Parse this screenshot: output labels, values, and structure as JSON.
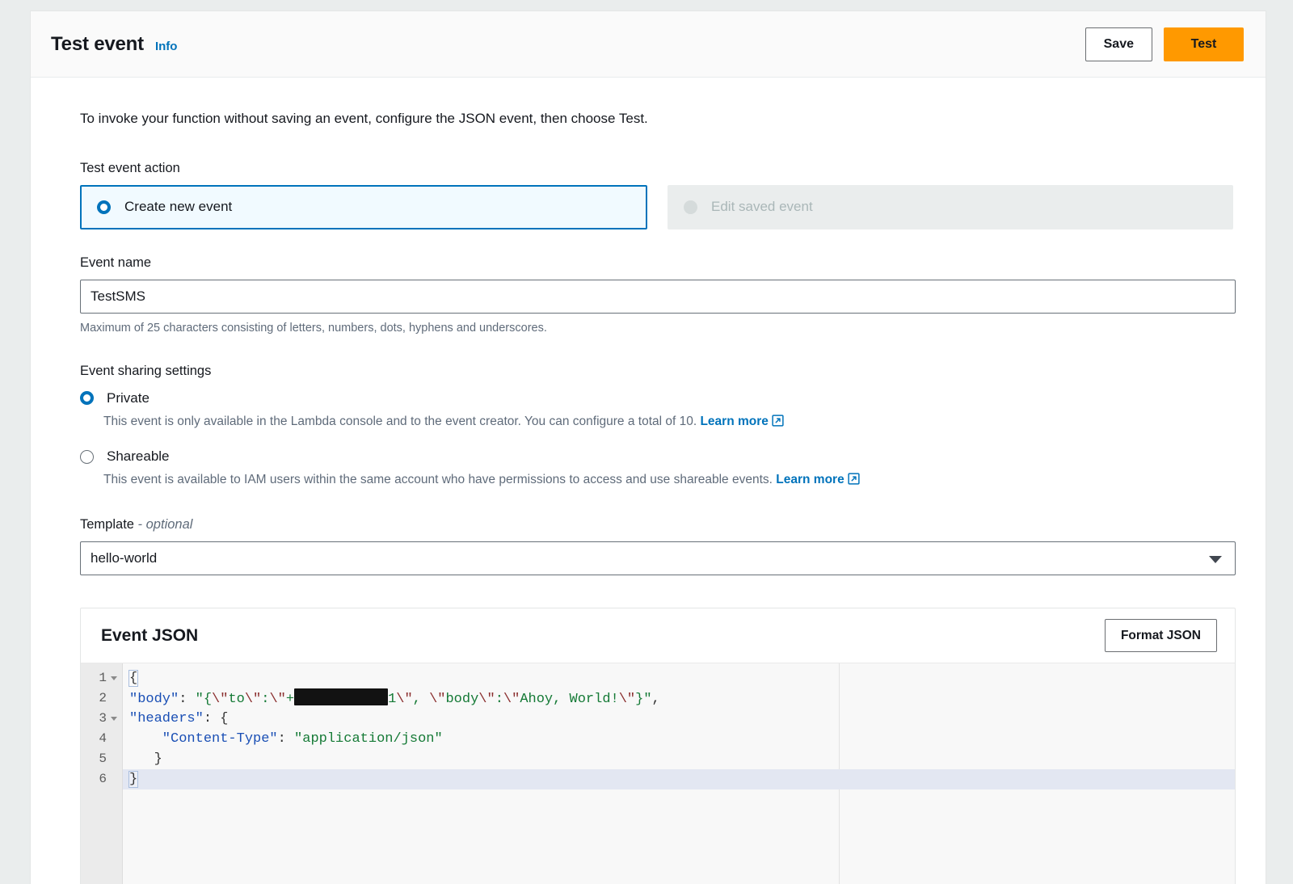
{
  "header": {
    "title": "Test event",
    "info_link": "Info",
    "save_label": "Save",
    "test_label": "Test"
  },
  "body": {
    "intro": "To invoke your function without saving an event, configure the JSON event, then choose Test."
  },
  "test_event_action": {
    "label": "Test event action",
    "options": [
      {
        "label": "Create new event",
        "selected": true,
        "disabled": false
      },
      {
        "label": "Edit saved event",
        "selected": false,
        "disabled": true
      }
    ]
  },
  "event_name": {
    "label": "Event name",
    "value": "TestSMS",
    "placeholder": "",
    "constraint": "Maximum of 25 characters consisting of letters, numbers, dots, hyphens and underscores."
  },
  "event_sharing": {
    "label": "Event sharing settings",
    "options": [
      {
        "label": "Private",
        "selected": true,
        "description": "This event is only available in the Lambda console and to the event creator. You can configure a total of 10.",
        "learn_more": "Learn more",
        "learn_more_icon": "external-link-icon"
      },
      {
        "label": "Shareable",
        "selected": false,
        "description": "This event is available to IAM users within the same account who have permissions to access and use shareable events.",
        "learn_more": "Learn more",
        "learn_more_icon": "external-link-icon"
      }
    ]
  },
  "template": {
    "label_main": "Template",
    "label_optional": "- optional",
    "selected": "hello-world",
    "caret_icon": "chevron-down-icon"
  },
  "event_json": {
    "title": "Event JSON",
    "format_button": "Format JSON",
    "active_line": 6,
    "lines": [
      {
        "number": "1",
        "foldable": true
      },
      {
        "number": "2",
        "foldable": false
      },
      {
        "number": "3",
        "foldable": true
      },
      {
        "number": "4",
        "foldable": false
      },
      {
        "number": "5",
        "foldable": false
      },
      {
        "number": "6",
        "foldable": false
      }
    ],
    "code": {
      "line1": "{",
      "line2_key": "\"body\"",
      "line2_colon": ": ",
      "line2_a": "\"{",
      "line2_esc1": "\\\"",
      "line2_b": "to",
      "line2_esc2": "\\\"",
      "line2_c": ":",
      "line2_esc3": "\\\"",
      "line2_d": "+",
      "line2_redacted": "redaction-bar",
      "line2_e": "1",
      "line2_esc4": "\\\"",
      "line2_f": ", ",
      "line2_esc5": "\\\"",
      "line2_g": "body",
      "line2_esc6": "\\\"",
      "line2_h": ":",
      "line2_esc7": "\\\"",
      "line2_i": "Ahoy, World!",
      "line2_esc8": "\\\"",
      "line2_j": "}\"",
      "line2_k": ",",
      "line3_key": "\"headers\"",
      "line3_rest": ": {",
      "line4_key": "    \"Content-Type\"",
      "line4_colon": ": ",
      "line4_val": "\"application/json\"",
      "line5": "   }",
      "line6": "}"
    }
  },
  "colors": {
    "accent_orange": "#ff9900",
    "link_blue": "#0073bb",
    "selected_tile_bg": "#f1faff",
    "page_bg": "#eaeded",
    "text_primary": "#16191f",
    "text_secondary": "#5f6b7a",
    "code_key": "#1a4fb5",
    "code_string": "#157a36",
    "code_escape": "#8b2f2f",
    "active_line": "#e3e7f2"
  }
}
